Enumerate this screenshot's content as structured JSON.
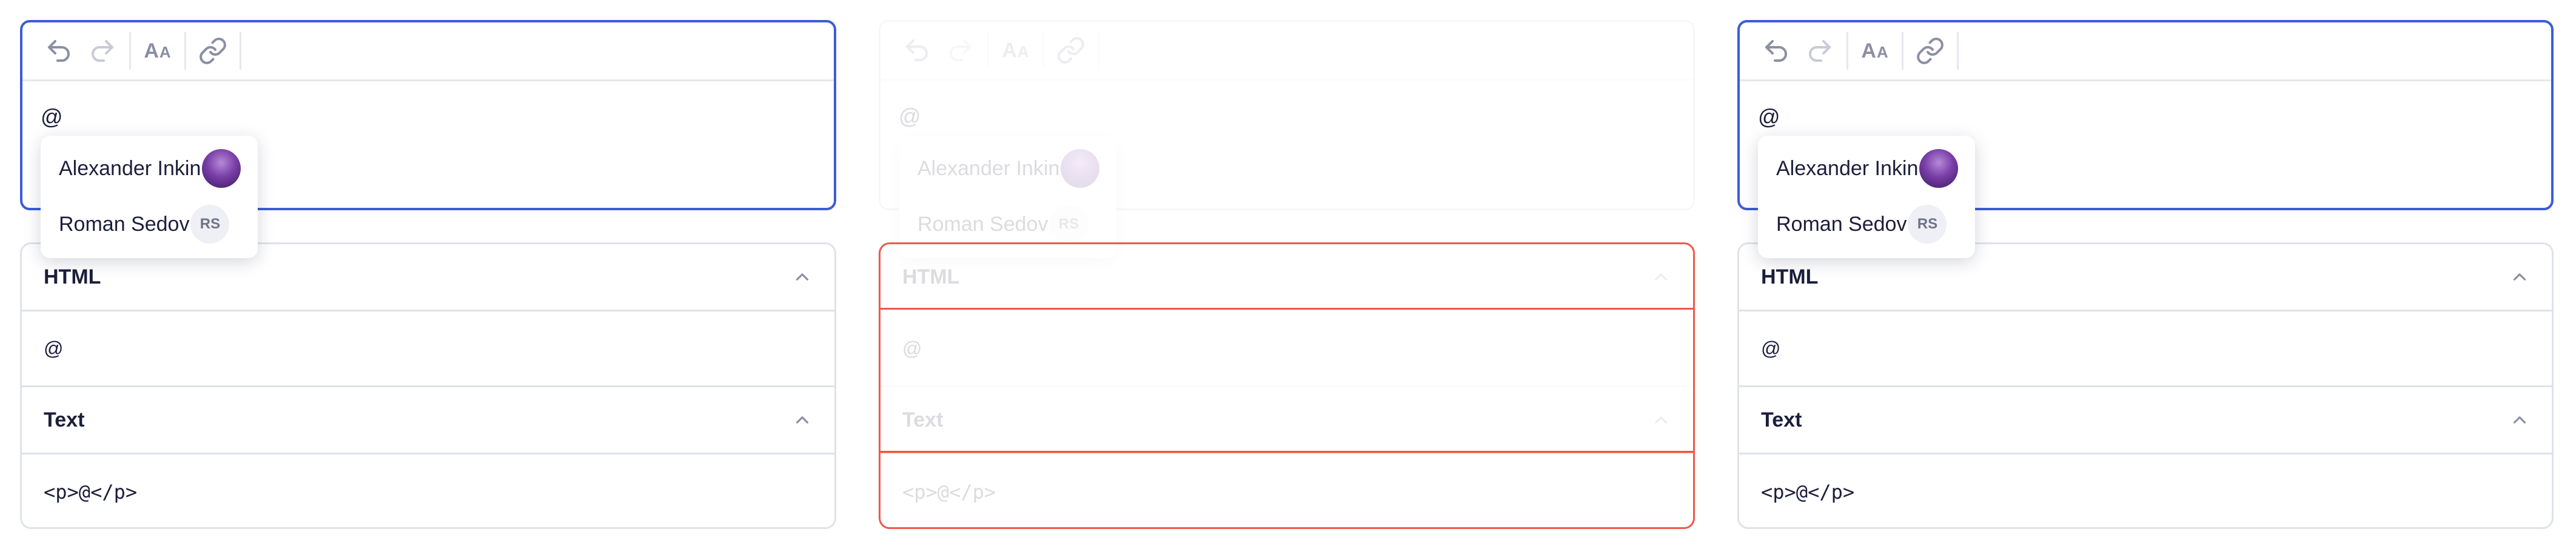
{
  "accent_color": "#3d5bd8",
  "diff_colors": {
    "removed": "#f0564a",
    "changed": "#f6a14a"
  },
  "panes": [
    {
      "editor": {
        "text": "@",
        "toolbar": [
          "undo-icon",
          "redo-icon",
          "font-size-icon",
          "link-icon"
        ]
      },
      "mentions": [
        {
          "name": "Alexander Inkin",
          "avatar": "photo"
        },
        {
          "name": "Roman Sedov",
          "avatar": "RS"
        }
      ],
      "html_section": {
        "title": "HTML",
        "content": "@"
      },
      "text_section": {
        "title": "Text",
        "content": "<p>@</p>"
      }
    },
    {
      "editor": {
        "text": "@",
        "toolbar": [
          "undo-icon",
          "redo-icon",
          "font-size-icon",
          "link-icon"
        ]
      },
      "mentions": [
        {
          "name": "Alexander Inkin",
          "avatar": "photo"
        },
        {
          "name": "Roman Sedov",
          "avatar": "RS"
        }
      ],
      "html_section": {
        "title": "HTML",
        "content": "@"
      },
      "text_section": {
        "title": "Text",
        "content": "<p>@</p>"
      }
    },
    {
      "editor": {
        "text": "@",
        "toolbar": [
          "undo-icon",
          "redo-icon",
          "font-size-icon",
          "link-icon"
        ]
      },
      "mentions": [
        {
          "name": "Alexander Inkin",
          "avatar": "photo"
        },
        {
          "name": "Roman Sedov",
          "avatar": "RS"
        }
      ],
      "html_section": {
        "title": "HTML",
        "content": "@"
      },
      "text_section": {
        "title": "Text",
        "content": "<p>@</p>"
      }
    }
  ]
}
